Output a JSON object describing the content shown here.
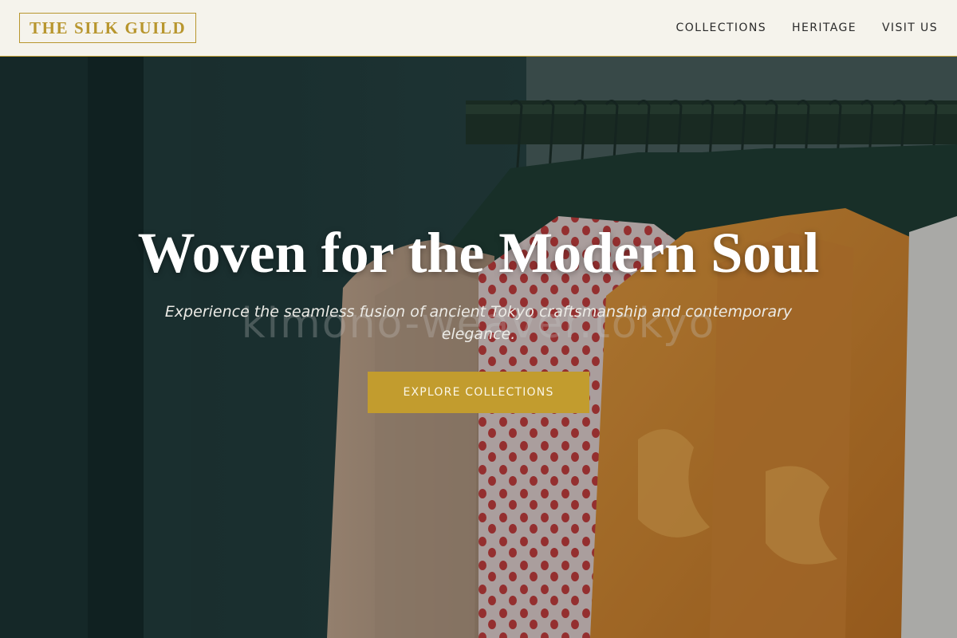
{
  "header": {
    "logo_text": "THE SILK GUILD",
    "nav": [
      {
        "label": "COLLECTIONS"
      },
      {
        "label": "HERITAGE"
      },
      {
        "label": "VISIT US"
      }
    ]
  },
  "hero": {
    "headline": "Woven for the Modern Soul",
    "subtitle": "Experience the seamless fusion of ancient Tokyo craftsmanship and contemporary elegance.",
    "watermark": "kimono-weaver.tokyo",
    "cta_label": "EXPLORE COLLECTIONS",
    "image": "clothing-rack-garments"
  },
  "colors": {
    "accent_gold": "#c29c2e",
    "header_bg": "#f5f3ec",
    "hero_dark": "#1f3535"
  }
}
